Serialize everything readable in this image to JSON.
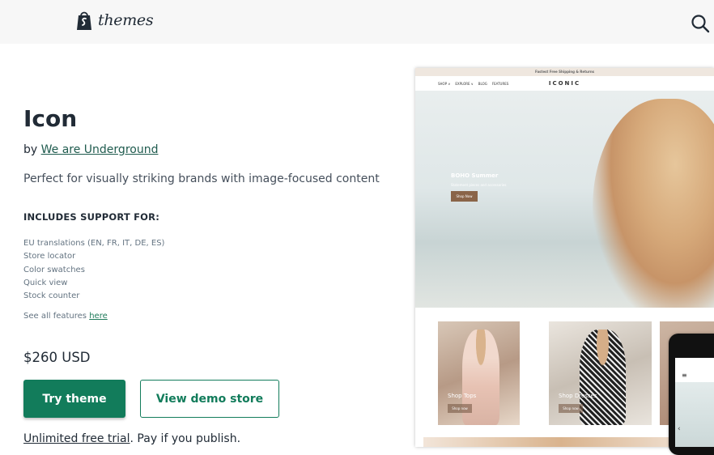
{
  "header": {
    "logo_text": "themes"
  },
  "theme": {
    "name": "Icon",
    "by_prefix": "by",
    "author": "We are Underground",
    "tagline": "Perfect for visually striking brands with image-focused content",
    "support_heading": "INCLUDES SUPPORT FOR:",
    "features": [
      "EU translations (EN, FR, IT, DE, ES)",
      "Store locator",
      "Color swatches",
      "Quick view",
      "Stock counter"
    ],
    "see_all_prefix": "See all features",
    "see_all_link": "here",
    "price": "$260 USD",
    "try_label": "Try theme",
    "demo_label": "View demo store",
    "trial_link": "Unlimited free trial",
    "trial_rest": ". Pay if you publish."
  },
  "preview": {
    "announcement": "Fastest Free Shipping & Returns",
    "nav": [
      "SHOP ∨",
      "EXPLORE ∨",
      "BLOG",
      "FEATURES"
    ],
    "brand": "ICONIC",
    "hero_title": "BOHO Summer",
    "hero_sub": "Statement pieces and accessories",
    "hero_btn": "Shop Now",
    "tiles": [
      {
        "label": "Shop Tops",
        "btn": "Shop now"
      },
      {
        "label": "Shop Dresses",
        "btn": "Shop now"
      }
    ]
  },
  "colors": {
    "primary": "#127c5b",
    "link": "#1f5b4e"
  }
}
